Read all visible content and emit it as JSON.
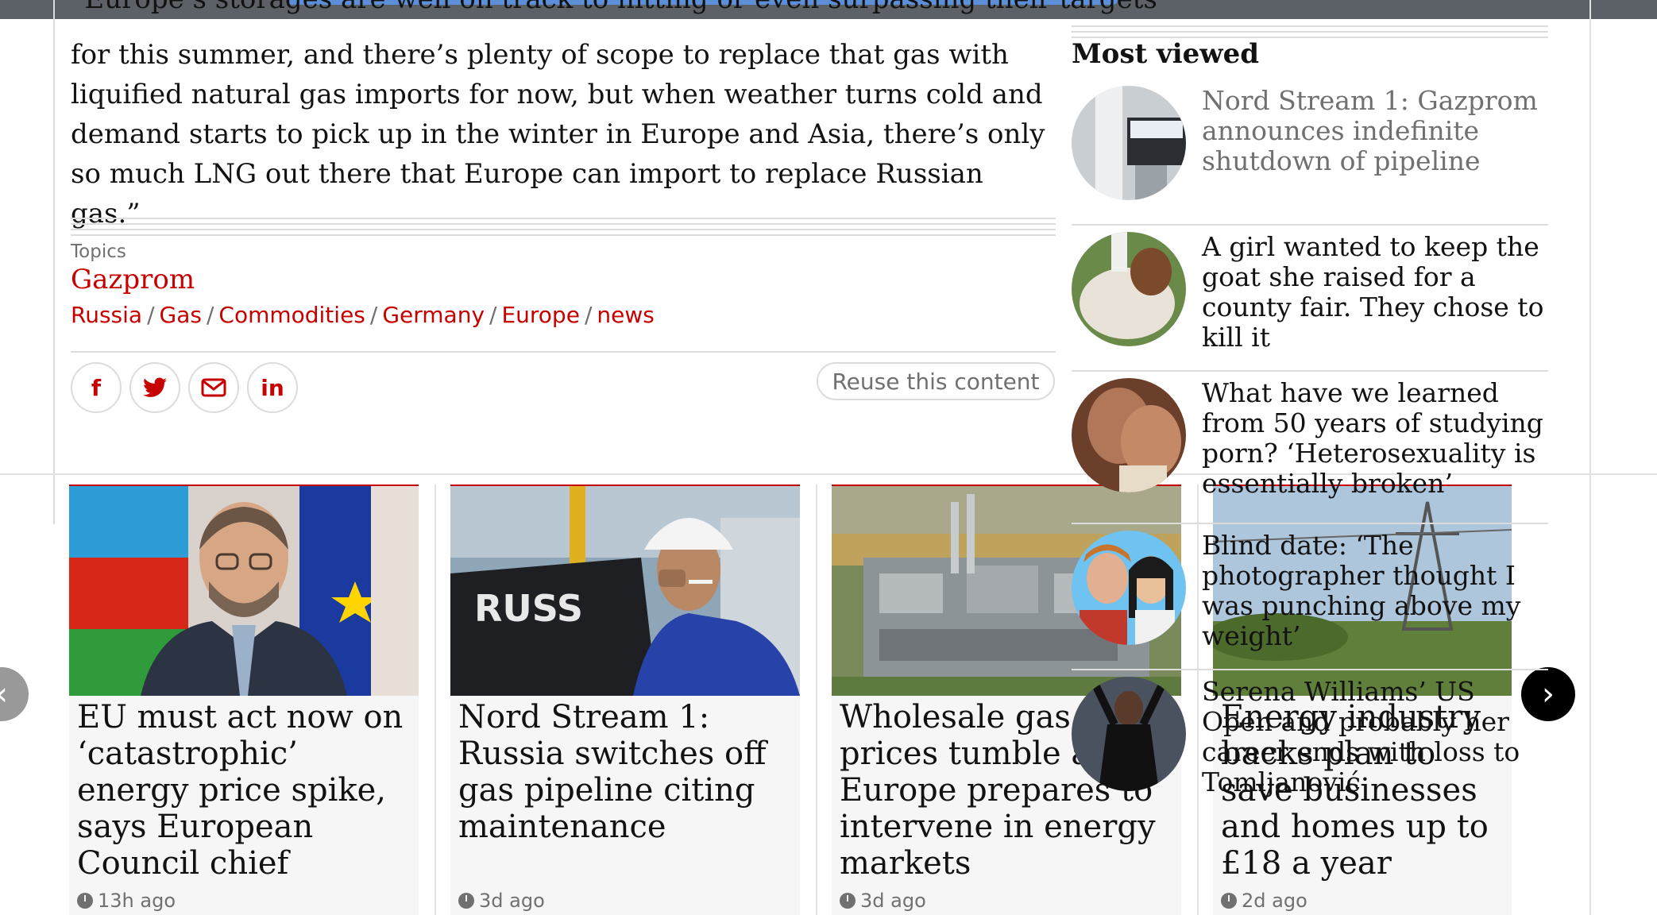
{
  "article": {
    "quote_top_fragment": "“Europe’s storages are well on track to hitting or even surpassing their targets",
    "quote_text": "for this summer, and there’s plenty of scope to replace that gas with liquified natural gas imports for now, but when weather turns cold and demand starts to pick up in the winter in Europe and Asia, there’s only so much LNG out there that Europe can import to replace Russian gas.”"
  },
  "topics": {
    "label": "Topics",
    "main": "Gazprom",
    "items": [
      "Russia",
      "Gas",
      "Commodities",
      "Germany",
      "Europe",
      "news"
    ],
    "separator": "/"
  },
  "share": {
    "facebook_icon": "f",
    "twitter_icon": "twitter-bird",
    "email_icon": "envelope",
    "linkedin_icon": "in",
    "reuse_label": "Reuse this content"
  },
  "most_viewed": {
    "title": "Most viewed",
    "items": [
      {
        "headline": "Nord Stream 1: Gazprom announces indefinite shutdown of pipeline"
      },
      {
        "headline": "A girl wanted to keep the goat she raised for a county fair. They chose to kill it"
      },
      {
        "headline": "What have we learned from 50 years of studying porn? ‘Heterosexuality is essentially broken’"
      },
      {
        "headline": "Blind date: ‘The photographer thought I was punching above my weight’"
      },
      {
        "headline": "Serena Williams’ US Open and probably her career ends with loss to Tomljanović"
      }
    ]
  },
  "cards": [
    {
      "headline": "EU must act now on ‘catastrophic’ energy price spike, says European Council chief",
      "age": "13h ago"
    },
    {
      "headline": "Nord Stream 1: Russia switches off gas pipeline citing maintenance",
      "age": "3d ago"
    },
    {
      "headline": "Wholesale gas prices tumble as Europe prepares to intervene in energy markets",
      "age": "3d ago"
    },
    {
      "headline": "Energy industry backs plan to save businesses and homes up to £18 a year",
      "age": "2d ago"
    }
  ],
  "colors": {
    "accent": "#c70000",
    "muted": "#707070",
    "rule": "#dcdcdc"
  }
}
